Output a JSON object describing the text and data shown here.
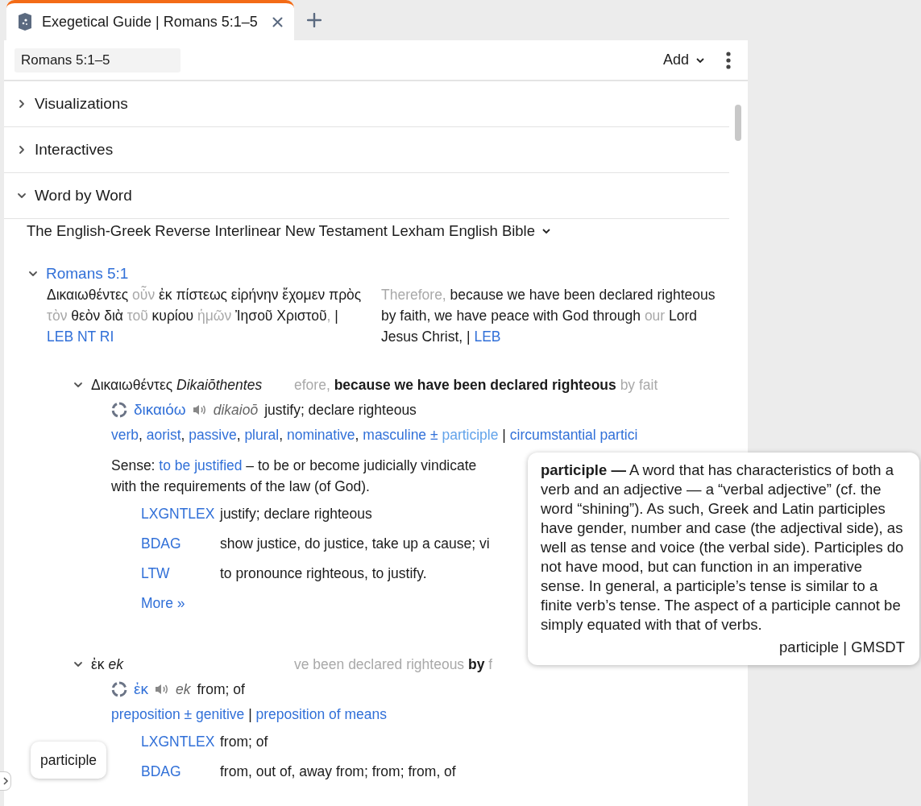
{
  "tabs": [
    {
      "label": "Exegetical Guide | Romans 5:1–5",
      "selected": true
    }
  ],
  "toolbar": {
    "reference": "Romans 5:1–5",
    "add_menu": "Add"
  },
  "sections": [
    {
      "title": "Visualizations",
      "expanded": false
    },
    {
      "title": "Interactives",
      "expanded": false
    },
    {
      "title": "Word by Word",
      "expanded": true
    }
  ],
  "word_by_word": {
    "bible": "The English-Greek Reverse Interlinear New Testament Lexham English Bible",
    "verse": {
      "reference": "Romans 5:1",
      "expanded": true,
      "greek": [
        {
          "text": "Δικαιωθέντες ",
          "kind": "normal"
        },
        {
          "text": "οὖν",
          "kind": "dim"
        },
        {
          "text": " ἐκ πίστεως εἰρήνην ἔχομεν πρὸς ",
          "kind": "normal"
        },
        {
          "text": "τὸν",
          "kind": "dim"
        },
        {
          "text": " θεὸν διὰ ",
          "kind": "normal"
        },
        {
          "text": "τοῦ",
          "kind": "dim"
        },
        {
          "text": " κυρίου ",
          "kind": "normal"
        },
        {
          "text": "ἡμῶν",
          "kind": "dim"
        },
        {
          "text": " Ἰησοῦ Χριστοῦ",
          "kind": "normal"
        },
        {
          "text": ",",
          "kind": "dim"
        },
        {
          "text": " | ",
          "kind": "normal"
        }
      ],
      "greek_source": "LEB NT RI",
      "english": [
        {
          "text": "Therefore,",
          "kind": "dim"
        },
        {
          "text": " because we have been declared righteous by faith, we have peace with God through ",
          "kind": "normal"
        },
        {
          "text": "our",
          "kind": "dim"
        },
        {
          "text": " Lord Jesus Christ,  | ",
          "kind": "normal"
        }
      ],
      "english_source": "LEB"
    },
    "words": [
      {
        "greek": "Δικαιωθέντες",
        "translit": "Dikaiōthentes",
        "expanded": true,
        "context": [
          {
            "text": "efore, ",
            "kind": "dim"
          },
          {
            "text": "because we have been declared righteous ",
            "kind": "bold"
          },
          {
            "text": "by fait",
            "kind": "dim"
          }
        ],
        "lemma": "δικαιόω",
        "lemma_translit": "dikaioō",
        "gloss": "justify; declare righteous",
        "morphology": [
          {
            "text": "verb",
            "kind": "link"
          },
          {
            "text": ", ",
            "kind": "plain"
          },
          {
            "text": "aorist",
            "kind": "link"
          },
          {
            "text": ", ",
            "kind": "plain"
          },
          {
            "text": "passive",
            "kind": "link"
          },
          {
            "text": ", ",
            "kind": "plain"
          },
          {
            "text": "plural",
            "kind": "link"
          },
          {
            "text": ", ",
            "kind": "plain"
          },
          {
            "text": "nominative",
            "kind": "link"
          },
          {
            "text": ", ",
            "kind": "plain"
          },
          {
            "text": "masculine ± ",
            "kind": "link"
          },
          {
            "text": "participle",
            "kind": "hover"
          },
          {
            "text": " | ",
            "kind": "plain"
          },
          {
            "text": "circumstantial partici",
            "kind": "link"
          }
        ],
        "sense": {
          "label": "Sense:",
          "link": "to be justified",
          "text": " – to be or become judicially vindicate",
          "continuation": "with the requirements of the law (of God)."
        },
        "lexicons": [
          {
            "source": "LXGNTLEX",
            "gloss": "justify; declare righteous"
          },
          {
            "source": "BDAG",
            "gloss": "show justice, do justice, take up a cause; vi"
          },
          {
            "source": "LTW",
            "gloss": "to pronounce righteous, to justify."
          }
        ],
        "more": "More »"
      },
      {
        "greek": "ἐκ",
        "translit": "ek",
        "expanded": true,
        "context": [
          {
            "text": "ve been declared righteous ",
            "kind": "dim"
          },
          {
            "text": "by ",
            "kind": "bold"
          },
          {
            "text": "f",
            "kind": "dim"
          }
        ],
        "lemma": "ἐκ",
        "lemma_translit": "ek",
        "gloss": "from; of",
        "morphology": [
          {
            "text": "preposition ± genitive",
            "kind": "link"
          },
          {
            "text": " | ",
            "kind": "plain"
          },
          {
            "text": "preposition of means",
            "kind": "link"
          }
        ],
        "lexicons": [
          {
            "source": "LXGNTLEX",
            "gloss": "from; of"
          },
          {
            "source": "BDAG",
            "gloss": "from, out of, away from; from; from, of"
          }
        ]
      }
    ]
  },
  "popup": {
    "definition": "**participle —** A word that has characteristics of both a verb and an adjective — a “verbal adjective” (cf. the word “shining”). As such, Greek and Latin participles have gender, number and case (the adjectival side), as well as tense and voice (the verbal side). Participles do not have mood, but can function in an imperative sense. In general, a participle’s tense is similar to a finite verb’s tense. The aspect of a participle cannot be simply equated with that of verbs.",
    "source": "participle | GMSDT"
  },
  "hover_tooltip": "participle"
}
